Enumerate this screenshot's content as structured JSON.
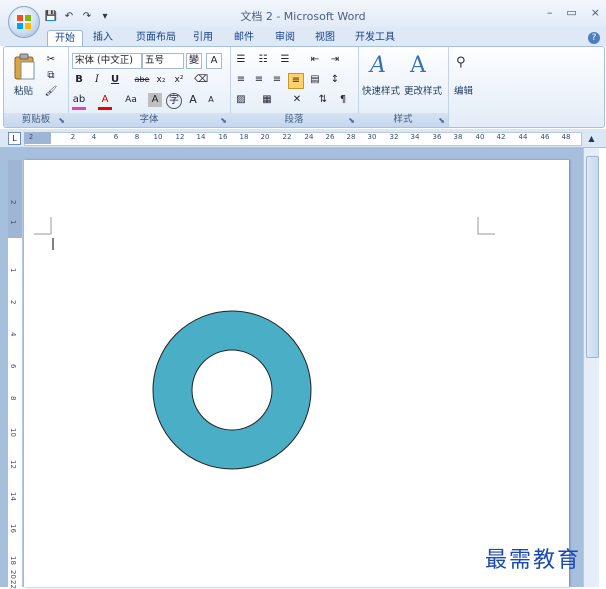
{
  "window": {
    "title": "文档 2 - Microsoft Word",
    "min": "–",
    "max": "▭",
    "close": "×"
  },
  "qat": {
    "save": "💾",
    "undo": "↶",
    "redo": "↷",
    "customize": "▾"
  },
  "tabs": [
    "开始",
    "插入",
    "页面布局",
    "引用",
    "邮件",
    "审阅",
    "视图",
    "开发工具"
  ],
  "active_tab": "开始",
  "help": "?",
  "clipboard": {
    "paste_label": "粘贴",
    "group_label": "剪贴板"
  },
  "font": {
    "face": "宋体 (中文正)",
    "size": "五号",
    "bold": "B",
    "italic": "I",
    "underline": "U",
    "strike": "abe",
    "sub": "x₂",
    "sup": "x²",
    "case": "Aa",
    "grow": "A",
    "shrink": "A",
    "clear": "A",
    "group_label": "字体"
  },
  "paragraph": {
    "group_label": "段落"
  },
  "styles": {
    "quick_label": "快速样式",
    "change_label": "更改样式",
    "group_label": "样式"
  },
  "editing": {
    "label": "编辑"
  },
  "ruler": {
    "ticks": [
      "2",
      "2",
      "4",
      "6",
      "8",
      "10",
      "12",
      "14",
      "16",
      "18",
      "20",
      "22",
      "24",
      "26",
      "28",
      "30",
      "32",
      "34",
      "36",
      "38",
      "40",
      "42",
      "44",
      "46",
      "48"
    ],
    "vticks": [
      "2",
      "1",
      "1",
      "2",
      "4",
      "6",
      "8",
      "10",
      "12",
      "14",
      "16",
      "18",
      "20",
      "22"
    ]
  },
  "shape": {
    "fill": "#4aaec7",
    "stroke": "#222222"
  },
  "watermark": "最需教育"
}
